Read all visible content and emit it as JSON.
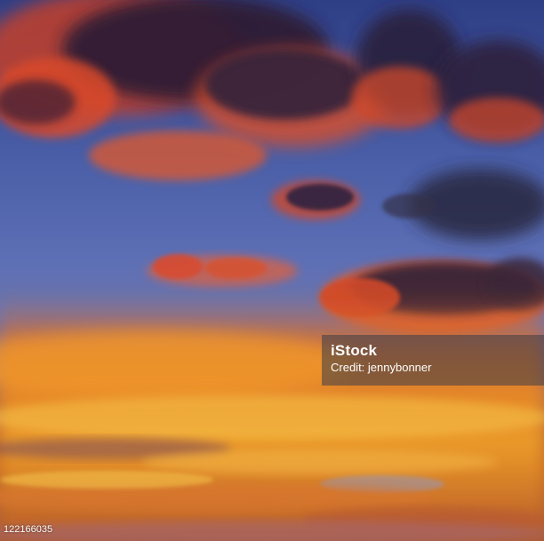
{
  "photo": {
    "subject": "sunset-sky-clouds",
    "colors": {
      "sky_top": "#2f3f86",
      "sky_mid": "#5d6fb5",
      "cloud_dark": "#3a2a4a",
      "cloud_glow_red": "#e0452a",
      "cloud_glow_orange": "#f08a24",
      "cloud_glow_gold": "#f5c04a"
    }
  },
  "watermark": {
    "brand": "iStock",
    "credit": "Credit: jennybonner"
  },
  "image_id": "122166035"
}
